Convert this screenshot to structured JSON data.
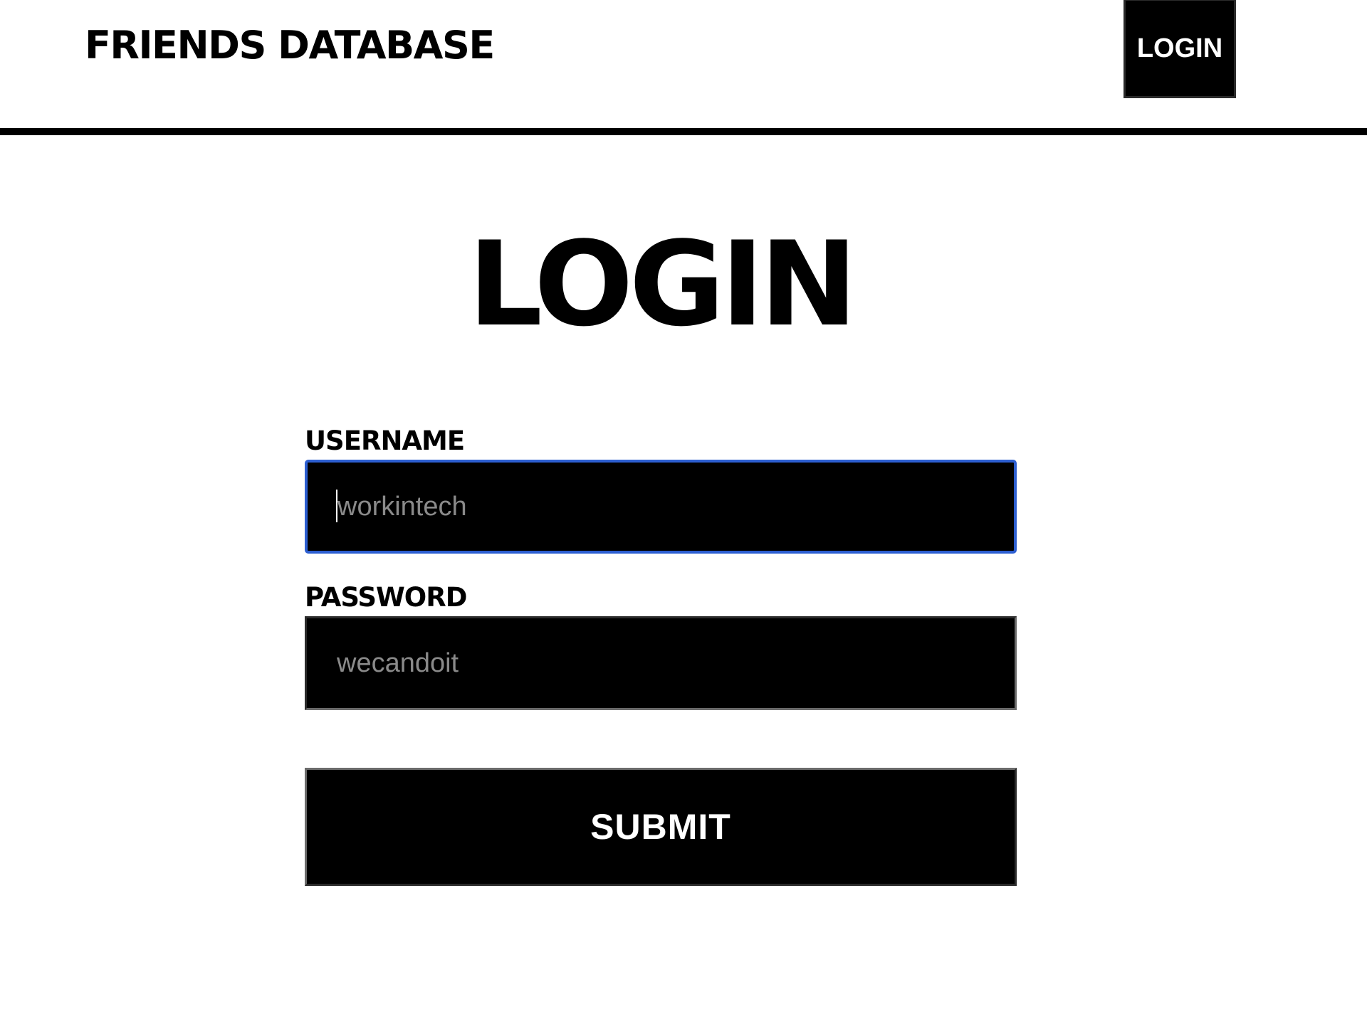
{
  "header": {
    "brand": "FRIENDS DATABASE",
    "nav_login_label": "LOGIN"
  },
  "main": {
    "title": "LOGIN",
    "form": {
      "username": {
        "label": "USERNAME",
        "placeholder": "workintech",
        "value": ""
      },
      "password": {
        "label": "PASSWORD",
        "placeholder": "wecandoit",
        "value": ""
      },
      "submit_label": "SUBMIT"
    }
  },
  "colors": {
    "background": "#ffffff",
    "primary": "#000000",
    "focus_ring": "#2d5fd1",
    "placeholder": "#8a8a8a"
  }
}
